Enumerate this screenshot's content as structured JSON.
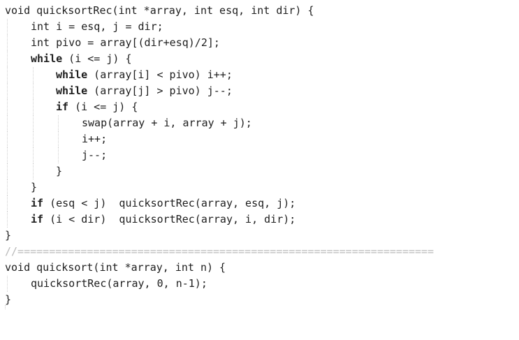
{
  "editor": {
    "lines": [
      {
        "text": "void quicksortRec(int *array, int esq, int dir) {"
      },
      {
        "text": "int i = esq, j = dir;"
      },
      {
        "text": "int pivo = array[(dir+esq)/2];"
      },
      {
        "kw": "while",
        "text": " (i <= j) {"
      },
      {
        "kw": "while",
        "text": " (array[i] < pivo) i++;"
      },
      {
        "kw": "while",
        "text": " (array[j] > pivo) j--;"
      },
      {
        "kw": "if",
        "text": " (i <= j) {"
      },
      {
        "text": "swap(array + i, array + j);"
      },
      {
        "text": "i++;"
      },
      {
        "text": "j--;"
      },
      {
        "text": "}"
      },
      {
        "text": "}"
      },
      {
        "kw": "if",
        "text": " (esq < j)  quicksortRec(array, esq, j);"
      },
      {
        "kw": "if",
        "text": " (i < dir)  quicksortRec(array, i, dir);"
      },
      {
        "text": "}"
      },
      {
        "text": "//=================================================================="
      },
      {
        "text": "void quicksort(int *array, int n) {"
      },
      {
        "text": "quicksortRec(array, 0, n-1);"
      },
      {
        "text": "}"
      }
    ]
  }
}
